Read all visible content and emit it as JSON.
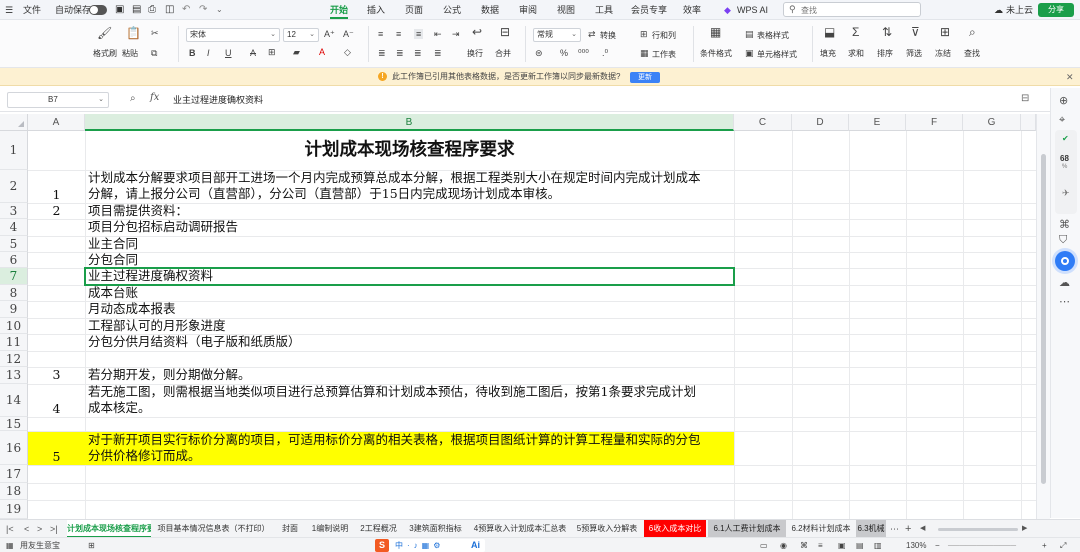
{
  "menubar": {
    "file": "文件",
    "autosave": "自动保存",
    "tabs": [
      "开始",
      "插入",
      "页面",
      "公式",
      "数据",
      "审阅",
      "视图",
      "工具",
      "会员专享",
      "效率"
    ],
    "active_tab": "开始",
    "wps_ai": "WPS AI",
    "search_placeholder": "查找",
    "cloud": "未上云",
    "share": "分享"
  },
  "ribbon": {
    "format_painter": "格式刷",
    "paste": "粘贴",
    "font_name": "宋体",
    "font_size": "12",
    "number_format": "常规",
    "convert": "转换",
    "rows_cols": "行和列",
    "wrap": "换行",
    "merge": "合并",
    "worksheet": "工作表",
    "table_style": "表格样式",
    "cond_format": "条件格式",
    "cell_style": "单元格样式",
    "fill": "填充",
    "sum": "求和",
    "sort": "排序",
    "filter": "筛选",
    "freeze": "冻结",
    "find": "查找"
  },
  "notice": {
    "message": "此工作簿已引用其他表格数据，是否更新工作簿以同步最新数据?",
    "button": "更新"
  },
  "formula_bar": {
    "cell_ref": "B7",
    "content": "业主过程进度确权资料"
  },
  "columns": [
    "A",
    "B",
    "C",
    "D",
    "E",
    "F",
    "G"
  ],
  "rows": [
    "1",
    "2",
    "3",
    "4",
    "5",
    "6",
    "7",
    "8",
    "9",
    "10",
    "11",
    "12",
    "13",
    "14",
    "15",
    "16",
    "17",
    "18",
    "19"
  ],
  "sheet": {
    "title": "计划成本现场核查程序要求",
    "r2_a": "1",
    "r2_b1": "计划成本分解要求项目部开工进场一个月内完成预算总成本分解，根据工程类别大小在规定时间内完成计划成本",
    "r2_b2": "分解，请上报分公司（直营部），分公司（直营部）于15日内完成现场计划成本审核。",
    "r3_a": "2",
    "r3_b": "项目需提供资料：",
    "r4_b": "项目分包招标启动调研报告",
    "r5_b": "业主合同",
    "r6_b": "分包合同",
    "r7_b": "业主过程进度确权资料",
    "r8_b": "成本台账",
    "r9_b": "月动态成本报表",
    "r10_b": "工程部认可的月形象进度",
    "r11_b": "分包分供月结资料（电子版和纸质版）",
    "r13_a": "3",
    "r13_b": "若分期开发，则分期做分解。",
    "r14_a": "4",
    "r14_b1": "若无施工图，则需根据当地类似项目进行总预算估算和计划成本预估，待收到施工图后，按第1条要求完成计划",
    "r14_b2": "成本核定。",
    "r16_a": "5",
    "r16_b1": "对于新开项目实行标价分离的项目，可适用标价分离的相关表格，根据项目图纸计算的计算工程量和实际的分包",
    "r16_b2": "分供价格修订而成。"
  },
  "rail": {
    "perf_value": "68",
    "perf_unit": "%"
  },
  "sheet_tabs": [
    "计划成本现场核查程序要求",
    "项目基本情况信息表（不打印）",
    "封面",
    "1编制说明",
    "2工程概况",
    "3建筑面积指标",
    "4预算收入计划成本汇总表",
    "5预算收入分解表",
    "6收入成本对比",
    "6.1人工费计划成本",
    "6.2材料计划成本",
    "6.3机械"
  ],
  "status": {
    "left": "用友生意宝",
    "zoom": "130%"
  },
  "colors": {
    "accent": "#1a9e4a",
    "highlight": "#ffff00",
    "red_tab": "#ff0000"
  }
}
